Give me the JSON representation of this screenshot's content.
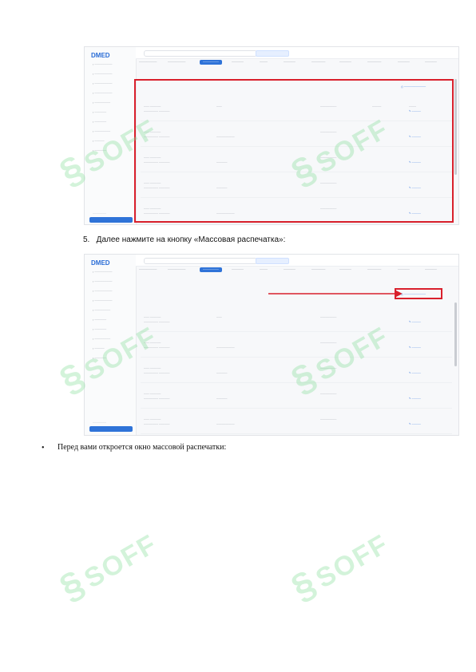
{
  "step5_text": "5.   Далее нажмите на кнопку «Массовая распечатка»:",
  "bullet_symbol": "•",
  "bullet_text": "Перед вами откроется окно массовой распечатки:",
  "app_logo": "DMED",
  "watermark_text": "SOFF",
  "colors": {
    "accent": "#2f73d8",
    "highlight": "#d9202c",
    "watermark": "#82dc96"
  }
}
